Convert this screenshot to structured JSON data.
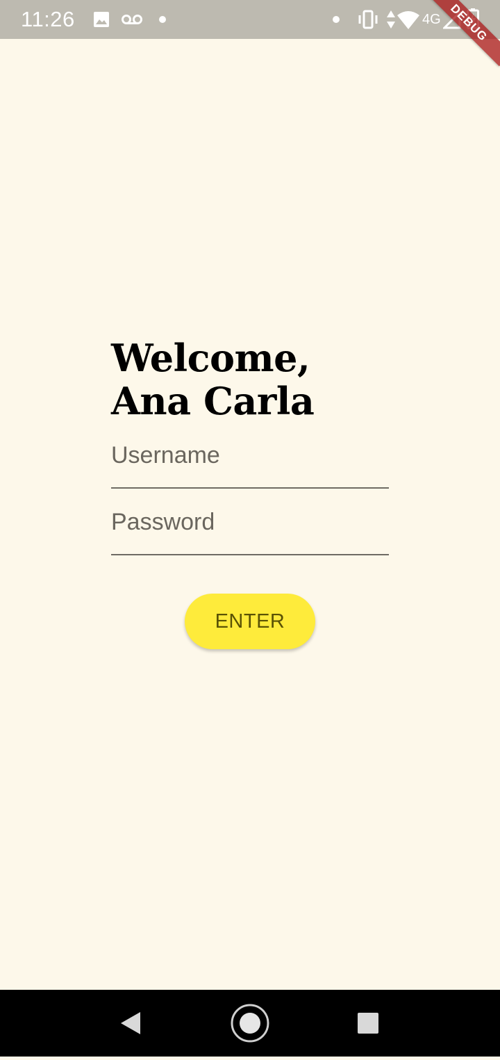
{
  "status_bar": {
    "time": "11:26",
    "network": "4G",
    "icons": [
      "image-icon",
      "voicemail-icon",
      "notification-dot-icon",
      "vibrate-icon",
      "wifi-icon",
      "signal-icon",
      "battery-charging-icon"
    ]
  },
  "debug_banner": {
    "label": "DEBUG"
  },
  "welcome": {
    "line1": "Welcome,",
    "line2": "Ana Carla"
  },
  "form": {
    "username_label": "Username",
    "password_label": "Password",
    "enter_label": "ENTER"
  },
  "nav_bar": {
    "icons": [
      "back-icon",
      "home-icon",
      "recents-icon"
    ]
  },
  "colors": {
    "background": "#fdf8ea",
    "status_bar": "#bdbab0",
    "button": "#feeb3b",
    "button_text": "#5a5205",
    "label_text": "#6a665e"
  }
}
